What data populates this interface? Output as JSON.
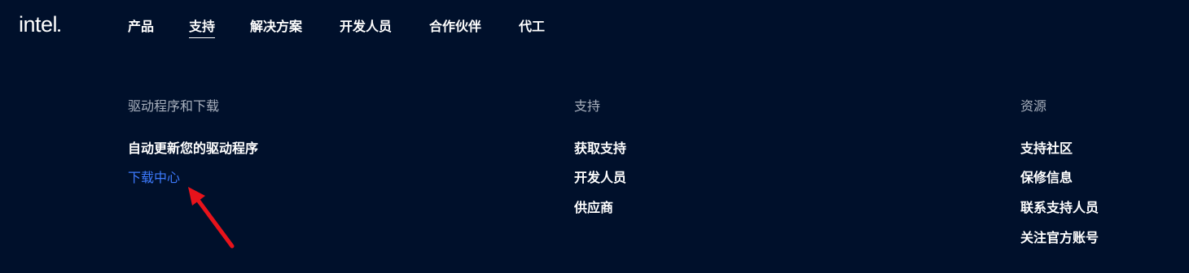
{
  "logo": {
    "text": "intel"
  },
  "nav": {
    "items": [
      {
        "label": "产品",
        "active": false
      },
      {
        "label": "支持",
        "active": true
      },
      {
        "label": "解决方案",
        "active": false
      },
      {
        "label": "开发人员",
        "active": false
      },
      {
        "label": "合作伙伴",
        "active": false
      },
      {
        "label": "代工",
        "active": false
      }
    ]
  },
  "menu": {
    "columns": [
      {
        "heading": "驱动程序和下载",
        "links": [
          {
            "label": "自动更新您的驱动程序",
            "highlighted": false
          },
          {
            "label": "下载中心",
            "highlighted": true
          }
        ]
      },
      {
        "heading": "支持",
        "links": [
          {
            "label": "获取支持",
            "highlighted": false
          },
          {
            "label": "开发人员",
            "highlighted": false
          },
          {
            "label": "供应商",
            "highlighted": false
          }
        ]
      },
      {
        "heading": "资源",
        "links": [
          {
            "label": "支持社区",
            "highlighted": false
          },
          {
            "label": "保修信息",
            "highlighted": false
          },
          {
            "label": "联系支持人员",
            "highlighted": false
          },
          {
            "label": "关注官方账号",
            "highlighted": false
          }
        ]
      }
    ]
  },
  "colors": {
    "background": "#00102b",
    "text": "#ffffff",
    "heading": "#a8b0bd",
    "link_highlight": "#3d7bff",
    "annotation_arrow": "#e8131b"
  },
  "icons": {
    "annotation": "red-arrow-icon"
  }
}
